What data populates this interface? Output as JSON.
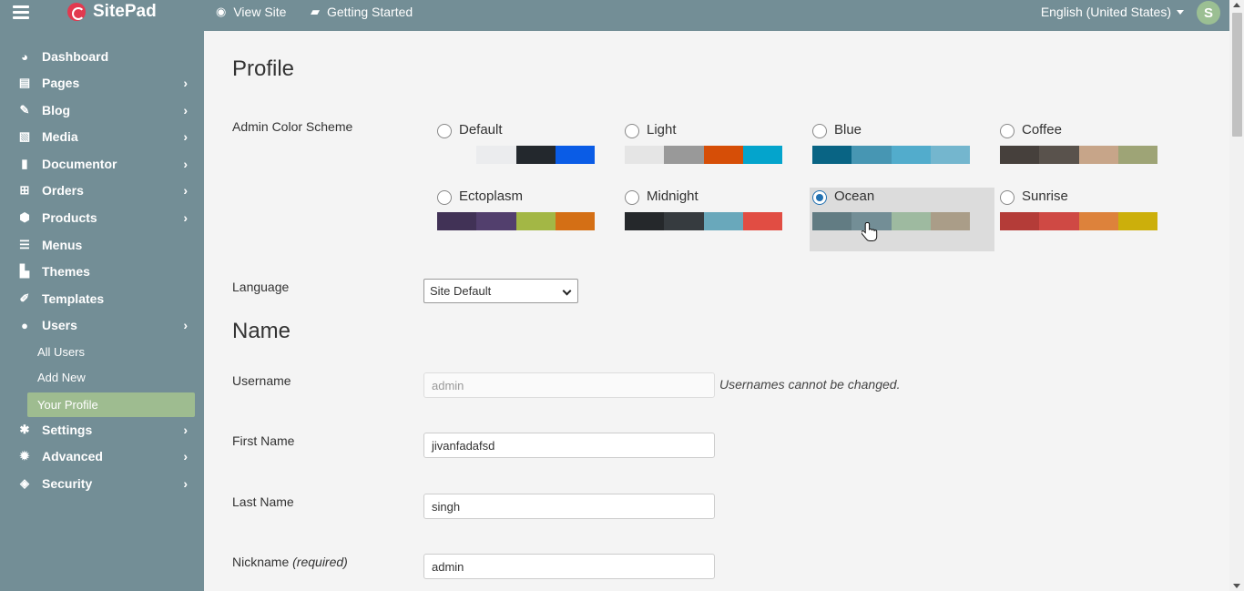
{
  "topbar": {
    "brand": "SitePad",
    "view_site": "View Site",
    "getting_started": "Getting Started",
    "language": "English (United States)",
    "avatar_letter": "S"
  },
  "sidebar": {
    "items": [
      {
        "label": "Dashboard",
        "icon": "dashboard-icon",
        "glyph": "◕"
      },
      {
        "label": "Pages",
        "icon": "pages-icon",
        "glyph": "▤"
      },
      {
        "label": "Blog",
        "icon": "pin-icon",
        "glyph": "✎"
      },
      {
        "label": "Media",
        "icon": "media-icon",
        "glyph": "▧"
      },
      {
        "label": "Documentor",
        "icon": "document-icon",
        "glyph": "▮"
      },
      {
        "label": "Orders",
        "icon": "cart-icon",
        "glyph": "⊞"
      },
      {
        "label": "Products",
        "icon": "box-icon",
        "glyph": "⬢"
      },
      {
        "label": "Menus",
        "icon": "menu-list-icon",
        "glyph": "☰"
      },
      {
        "label": "Themes",
        "icon": "brush-icon",
        "glyph": "▙"
      },
      {
        "label": "Templates",
        "icon": "paintbrush-icon",
        "glyph": "✐"
      },
      {
        "label": "Users",
        "icon": "user-icon",
        "glyph": "●"
      },
      {
        "label": "Settings",
        "icon": "settings-icon",
        "glyph": "✱"
      },
      {
        "label": "Advanced",
        "icon": "gear-icon",
        "glyph": "✹"
      },
      {
        "label": "Security",
        "icon": "shield-icon",
        "glyph": "◈"
      }
    ],
    "sub_items": [
      "All Users",
      "Add New",
      "Your Profile"
    ]
  },
  "main": {
    "title": "Profile",
    "color_scheme_label": "Admin Color Scheme",
    "schemes": [
      {
        "name": "Default",
        "colors": [
          "#f4f4f4",
          "#ebecee",
          "#23282d",
          "#0a5ce6"
        ],
        "selected": false
      },
      {
        "name": "Light",
        "colors": [
          "#e5e5e5",
          "#999999",
          "#d64e07",
          "#04a4cc"
        ],
        "selected": false
      },
      {
        "name": "Blue",
        "colors": [
          "#096484",
          "#4796b3",
          "#52accc",
          "#74b6ce"
        ],
        "selected": false
      },
      {
        "name": "Coffee",
        "colors": [
          "#46403c",
          "#59524c",
          "#c7a589",
          "#9ea476"
        ],
        "selected": false
      },
      {
        "name": "Ectoplasm",
        "colors": [
          "#413256",
          "#523f6d",
          "#a3b745",
          "#d46f15"
        ],
        "selected": false
      },
      {
        "name": "Midnight",
        "colors": [
          "#25282b",
          "#363b3f",
          "#69a8bb",
          "#e14d43"
        ],
        "selected": false
      },
      {
        "name": "Ocean",
        "colors": [
          "#627c83",
          "#738e96",
          "#9ebaa0",
          "#aa9d88"
        ],
        "selected": true
      },
      {
        "name": "Sunrise",
        "colors": [
          "#b43c38",
          "#cf4944",
          "#dd823b",
          "#ccaf0b"
        ],
        "selected": false
      }
    ],
    "language_label": "Language",
    "language_value": "Site Default",
    "name_heading": "Name",
    "username_label": "Username",
    "username_value": "admin",
    "username_hint": "Usernames cannot be changed.",
    "first_name_label": "First Name",
    "first_name_value": "jivanfadafsd",
    "last_name_label": "Last Name",
    "last_name_value": "singh",
    "nickname_label": "Nickname",
    "nickname_required": "(required)",
    "nickname_value": "admin"
  }
}
